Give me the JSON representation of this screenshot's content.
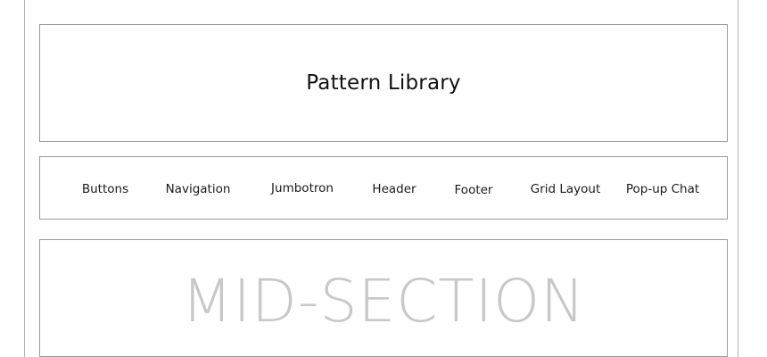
{
  "header": {
    "title": "Pattern Library"
  },
  "nav": {
    "items": [
      {
        "label": "Buttons"
      },
      {
        "label": "Navigation"
      },
      {
        "label": "Jumbotron"
      },
      {
        "label": "Header"
      },
      {
        "label": "Footer"
      },
      {
        "label": "Grid Layout"
      },
      {
        "label": "Pop-up Chat"
      }
    ]
  },
  "main": {
    "section_label": "MID-SECTION"
  },
  "colors": {
    "border": "#9a9a9a",
    "text": "#1a1a1a",
    "placeholder_text": "#c8c8c8",
    "background": "#ffffff"
  }
}
